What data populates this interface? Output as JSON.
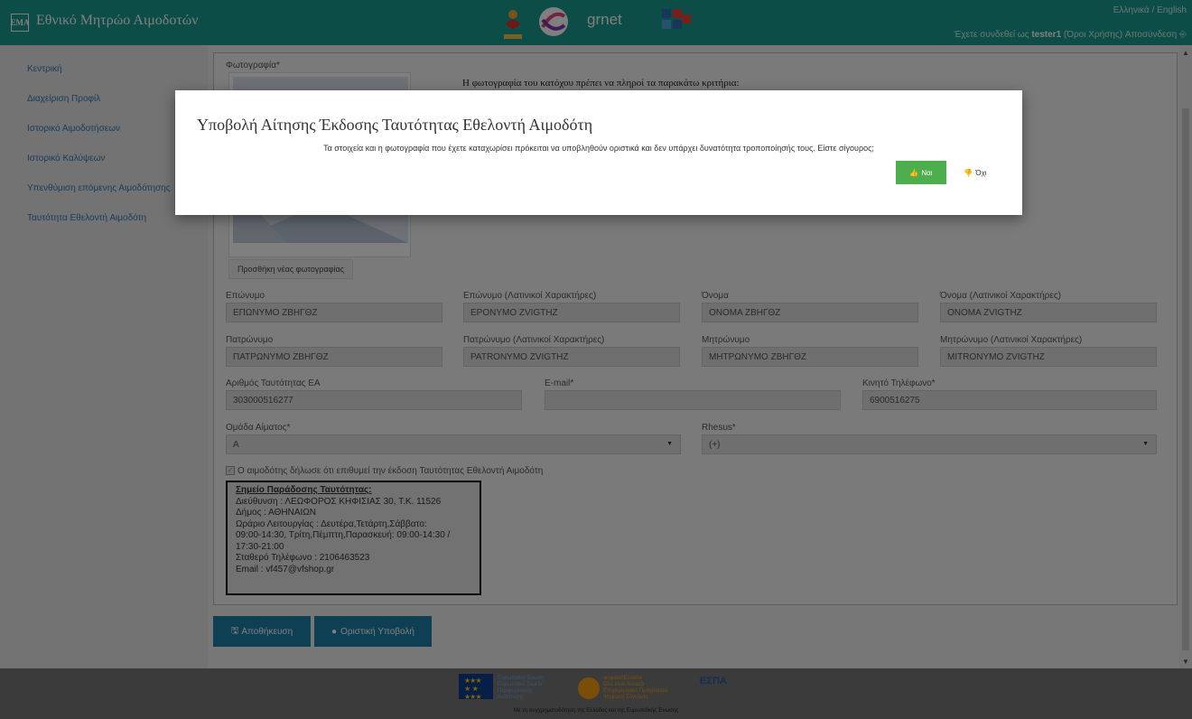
{
  "header": {
    "logo_text": "ΕΜΑ",
    "title": "Εθνικό Μητρώο Αιμοδοτών",
    "partner_grnet": "grnet",
    "lang_el": "Ελληνικά",
    "lang_sep": " / ",
    "lang_en": "English",
    "logged_in_prefix": "Έχετε συνδεθεί ως ",
    "username": "tester1",
    "terms": " (Όροι Χρήσης)",
    "logout": " Αποσύνδεση",
    "logout_icon": "⎆"
  },
  "sidebar": {
    "items": [
      {
        "label": "Κεντρική"
      },
      {
        "label": "Διαχείριση Προφίλ"
      },
      {
        "label": "Ιστορικό Αιμοδοτήσεων"
      },
      {
        "label": "Ιστορικό Καλύψεων"
      },
      {
        "label": "Υπενθύμιση επόμενης Αιμοδότησης"
      },
      {
        "label": "Ταυτότητα Εθελοντή Αιμοδότη"
      }
    ]
  },
  "form": {
    "photo_label": "Φωτογραφία*",
    "photo_criteria": "Η φωτογραφία του κατόχου πρέπει να πληροί τα παρακάτω κριτήρια:",
    "add_photo": "Προσθήκη νέας φωτογραφίας",
    "fields": {
      "surname": {
        "label": "Επώνυμο",
        "value": "ΕΠΩΝΥΜΟ ΖΒΗΓΘΖ"
      },
      "surname_latin": {
        "label": "Επώνυμο (Λατινικοί Χαρακτήρες)",
        "value": "EPONYMO ZVIGTHZ"
      },
      "name": {
        "label": "Όνομα",
        "value": "ΟΝΟΜΑ ΖΒΗΓΘΖ"
      },
      "name_latin": {
        "label": "Όνομα (Λατινικοί Χαρακτήρες)",
        "value": "ONOMA ZVIGTHZ"
      },
      "father": {
        "label": "Πατρώνυμο",
        "value": "ΠΑΤΡΩΝΥΜΟ ΖΒΗΓΘΖ"
      },
      "father_latin": {
        "label": "Πατρώνυμο (Λατινικοί Χαρακτήρες)",
        "value": "PATRONYMO ZVIGTHZ"
      },
      "mother": {
        "label": "Μητρώνυμο",
        "value": "ΜΗΤΡΩΝΥΜΟ ΖΒΗΓΘΖ"
      },
      "mother_latin": {
        "label": "Μητρώνυμο (Λατινικοί Χαρακτήρες)",
        "value": "MITRONYMO ZVIGTHZ"
      },
      "id_number": {
        "label": "Αριθμός Ταυτότητας ΕΑ",
        "value": "303000516277"
      },
      "email": {
        "label": "E-mail*",
        "value": ""
      },
      "mobile": {
        "label": "Κινητό Τηλέφωνο*",
        "value": "6900516275"
      },
      "blood_group": {
        "label": "Ομάδα Αίματος*",
        "value": "A"
      },
      "rhesus": {
        "label": "Rhesus*",
        "value": "(+)"
      }
    },
    "checkbox_label": "Ο αιμοδότης δήλωσε ότι επιθυμεί την έκδοση Ταυτότητας Εθελοντή Αιμοδότη",
    "delivery": {
      "title": "Σημείο Παράδοσης Ταυτότητας:",
      "lines": [
        "Διεύθυνση : ΛΕΩΦΟΡΟΣ ΚΗΦΙΣΙΑΣ 30, Τ.Κ. 11526",
        "Δήμος : ΑΘΗΝΑΙΩΝ",
        "Ωράριο Λειτουργίας : Δευτέρα,Τετάρτη,Σάββατο:",
        "09:00-14:30, Τρίτη,Πέμπτη,Παρασκευή: 09:00-14:30 /",
        "17:30-21:00",
        "Σταθερό Τηλέφωνο : 2106463523",
        "Email : vf457@vfshop.gr"
      ]
    },
    "save_button": "Αποθήκευση",
    "submit_button": "Οριστική Υποβολή"
  },
  "footer": {
    "eu_text": [
      "Ευρωπαϊκή Ένωση",
      "Ευρωπαϊκό Ταμείο",
      "Περιφερειακής",
      "Ανάπτυξης"
    ],
    "digital_greece": [
      "ψηφιακήΕλλάδα",
      "Όλα είναι δυνατά",
      "Επιχειρησιακό Πρόγραμμα",
      "Ψηφιακή Σύγκλιση"
    ],
    "espa": "ΕΣΠΑ",
    "caption": "Με τη συγχρηματοδότηση της Ελλάδας και της Ευρωπαϊκής Ένωσης"
  },
  "modal": {
    "title": "Υποβολή Αίτησης Έκδοσης Ταυτότητας Εθελοντή Αιμοδότη",
    "text": "Τα στοιχεία και η φωτογραφία που έχετε καταχωρίσει πρόκειται να υποβληθούν οριστικά και δεν υπάρχει δυνατότητα τροποποίησής τους. Είστε σίγουρος;",
    "yes": "Ναι",
    "no": "Όχι"
  },
  "colors": {
    "header": "#1b9a8e",
    "yes_button": "#4cae4c",
    "primary_button": "#1e7ea5",
    "link": "#337ab7"
  }
}
